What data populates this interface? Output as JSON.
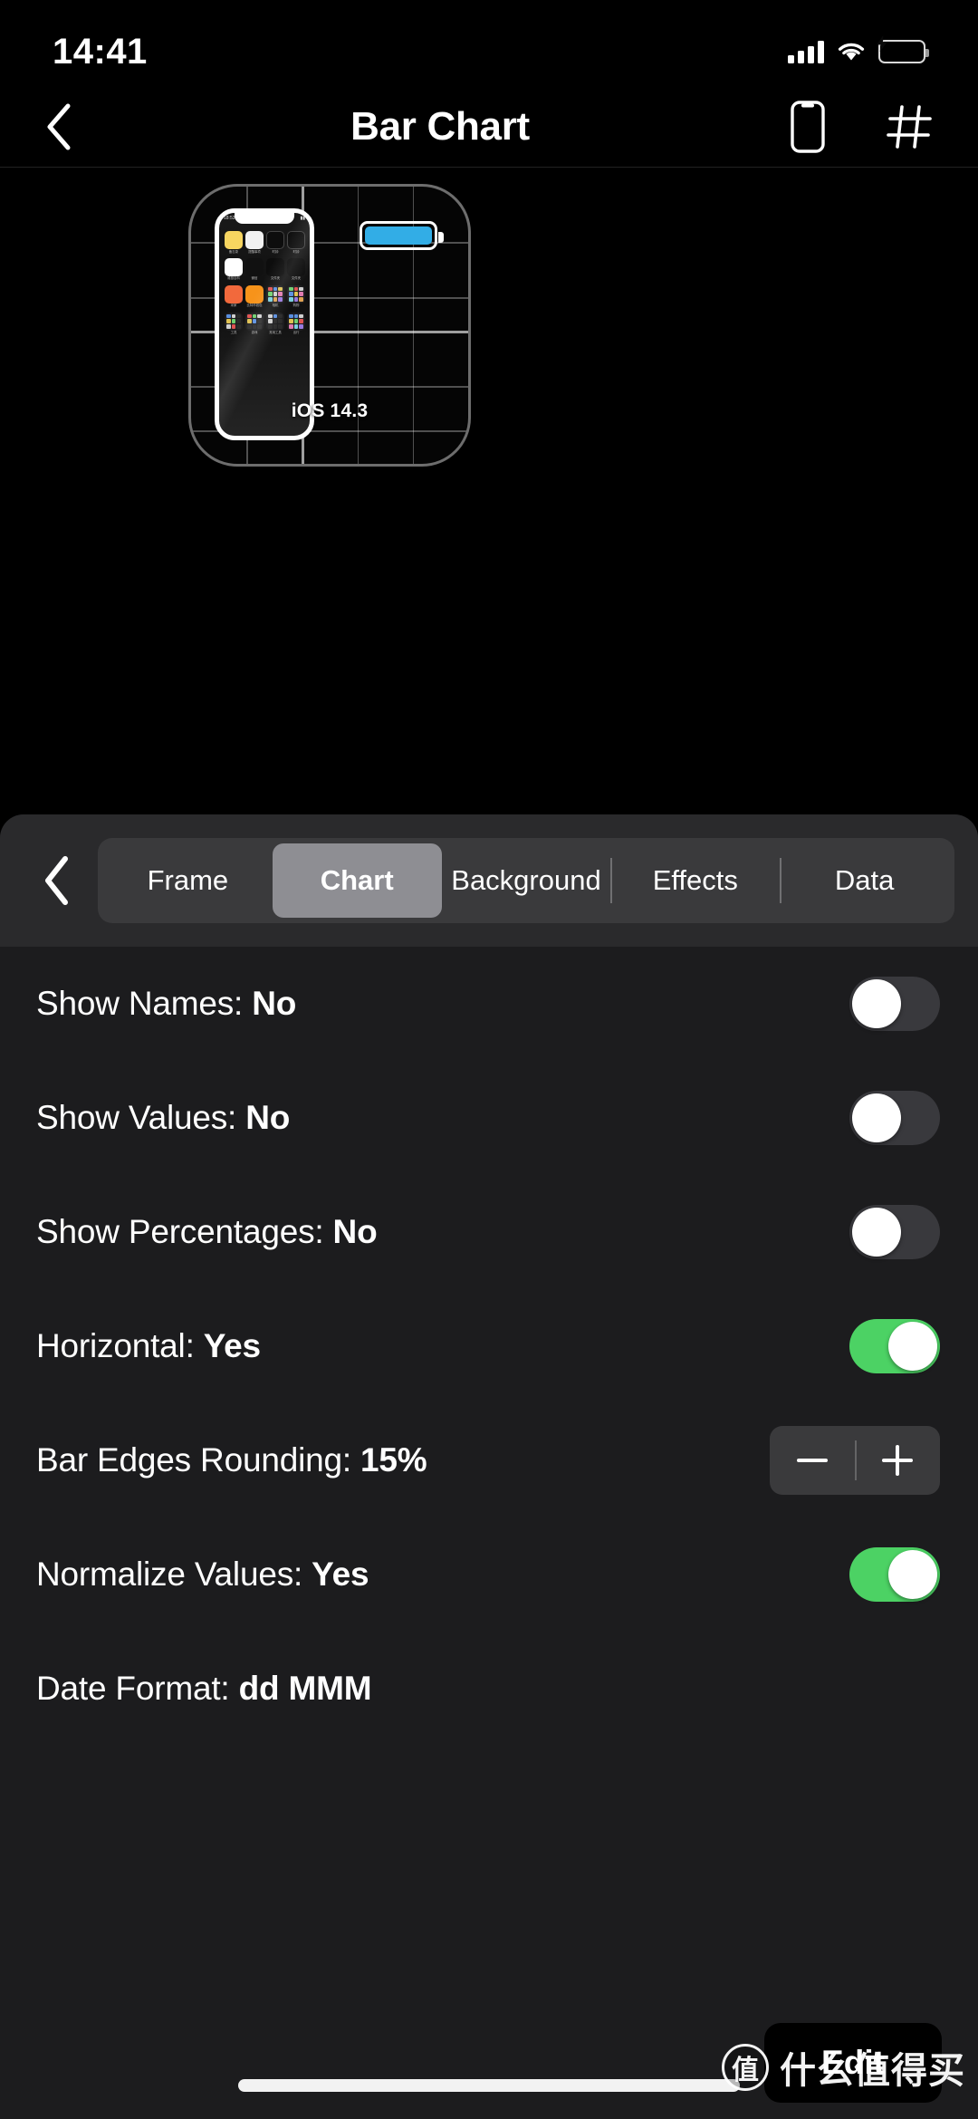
{
  "status_bar": {
    "time": "14:41",
    "cellular_icon": "cellular-bars-icon",
    "wifi_icon": "wifi-icon",
    "battery_icon": "battery-charging-icon",
    "battery_color": "#3ad961"
  },
  "nav": {
    "back_icon": "chevron-left-icon",
    "title": "Bar Chart",
    "device_icon": "iphone-icon",
    "grid_icon": "grid-icon"
  },
  "preview": {
    "widget_label": "iOS 14.3",
    "phone_status_time": "18:53",
    "apps": [
      {
        "name": "备忘录",
        "color": "#f7d560"
      },
      {
        "name": "提醒事项",
        "color": "#f2f2f2"
      },
      {
        "name": "时钟",
        "color": "#0d0d0d"
      },
      {
        "name": "时钟",
        "color": "#0d0d0d"
      },
      {
        "name": "维基百科",
        "color": "#ffffff"
      },
      {
        "name": "微信",
        "color": "#0d0d0d"
      },
      {
        "name": "文件夹",
        "color": "#1d1d1f"
      },
      {
        "name": "文件夹",
        "color": "#1d1d1f"
      },
      {
        "name": "米家",
        "color": "#f2693c"
      },
      {
        "name": "比特币钱包",
        "color": "#f7931a"
      },
      {
        "name": "相机",
        "color": "#1d1d1f"
      },
      {
        "name": "购物",
        "color": "#1d1d1f"
      },
      {
        "name": "工具",
        "color": "#1d1d1f"
      },
      {
        "name": "游戏",
        "color": "#1d1d1f"
      },
      {
        "name": "常用工具",
        "color": "#1d1d1f"
      },
      {
        "name": "出行",
        "color": "#1d1d1f"
      }
    ],
    "battery_bar_color": "#32ade6"
  },
  "segmented": {
    "back_icon": "chevron-left-icon",
    "items": [
      {
        "label": "Frame",
        "selected": false,
        "separator": false
      },
      {
        "label": "Chart",
        "selected": true,
        "separator": false
      },
      {
        "label": "Background",
        "selected": false,
        "separator": false
      },
      {
        "label": "Effects",
        "selected": false,
        "separator": true
      },
      {
        "label": "Data",
        "selected": false,
        "separator": true
      }
    ],
    "selected_color": "#8e8e93"
  },
  "settings": {
    "rows": [
      {
        "label": "Show Names: ",
        "value": "No",
        "control": "toggle",
        "on": false
      },
      {
        "label": "Show Values: ",
        "value": "No",
        "control": "toggle",
        "on": false
      },
      {
        "label": "Show Percentages: ",
        "value": "No",
        "control": "toggle",
        "on": false
      },
      {
        "label": "Horizontal: ",
        "value": "Yes",
        "control": "toggle",
        "on": true
      },
      {
        "label": "Bar Edges Rounding: ",
        "value": "15%",
        "control": "stepper",
        "minus": "−",
        "plus": "+"
      },
      {
        "label": "Normalize Values: ",
        "value": "Yes",
        "control": "toggle",
        "on": true
      },
      {
        "label": "Date Format: ",
        "value": "dd MMM",
        "control": "none"
      }
    ],
    "toggle_on_color": "#4cd264",
    "toggle_off_color": "#39393d"
  },
  "edit_button": {
    "label": "Edit"
  },
  "watermark": {
    "logo": "值",
    "text": "什么值得买"
  }
}
